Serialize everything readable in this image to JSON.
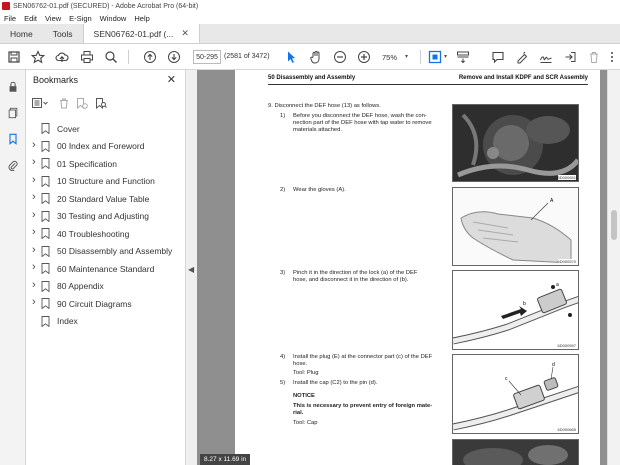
{
  "window": {
    "title": "SEN06762-01.pdf (SECURED) - Adobe Acrobat Pro (64-bit)"
  },
  "menu": [
    "File",
    "Edit",
    "View",
    "E-Sign",
    "Window",
    "Help"
  ],
  "tabs": {
    "home": "Home",
    "tools": "Tools",
    "document": "SEN06762-01.pdf (..."
  },
  "toolbar": {
    "page_input": "50-295",
    "page_count": "(2581 of 3472)",
    "zoom": "75%"
  },
  "bookmarks": {
    "header": "Bookmarks",
    "items": [
      {
        "label": "Cover",
        "expandable": false
      },
      {
        "label": "00 Index and Foreword",
        "expandable": true
      },
      {
        "label": "01 Specification",
        "expandable": true
      },
      {
        "label": "10 Structure and Function",
        "expandable": true
      },
      {
        "label": "20 Standard Value Table",
        "expandable": true
      },
      {
        "label": "30 Testing and Adjusting",
        "expandable": true
      },
      {
        "label": "40 Troubleshooting",
        "expandable": true
      },
      {
        "label": "50 Disassembly and Assembly",
        "expandable": true
      },
      {
        "label": "60 Maintenance Standard",
        "expandable": true
      },
      {
        "label": "80 Appendix",
        "expandable": true
      },
      {
        "label": "90 Circuit Diagrams",
        "expandable": true
      },
      {
        "label": "Index",
        "expandable": false
      }
    ]
  },
  "document": {
    "header_left": "50 Disassembly and Assembly",
    "header_right": "Remove and Install KDPF and SCR Assembly",
    "step_9": "9.   Disconnect the DEF hose (13) as follows.",
    "s1_num": "1)",
    "s1_text": [
      "Before you disconnect the DEF hose, wash the con-",
      "nection part of the DEF hose with tap water to remove",
      "materials attached."
    ],
    "s2_num": "2)",
    "s2_text": "Wear the gloves (A).",
    "s3_num": "3)",
    "s3_text": [
      "Pinch it in the direction of the lock (a) of the DEF",
      "hose, and disconnect it in the direction of (b)."
    ],
    "s4_num": "4)",
    "s4_text": [
      "Install the plug (E) at the connector part (c) of the DEF",
      "hose."
    ],
    "s4_tool": "Tool: Plug",
    "s5_num": "5)",
    "s5_text": "Install the cap (C2) to the pin (d).",
    "notice_title": "NOTICE",
    "notice_text": [
      "This is necessary to prevent entry of foreign mate-",
      "rial."
    ],
    "s5_tool": "Tool: Cap",
    "fig_codes": [
      "6D000651",
      "6D000570",
      "6D000597",
      "6D000665"
    ],
    "fig_labels": {
      "a": "a",
      "b": "b",
      "A": "A",
      "c": "c",
      "d": "d"
    }
  },
  "status": {
    "page_size": "8.27 x 11.69 in"
  }
}
